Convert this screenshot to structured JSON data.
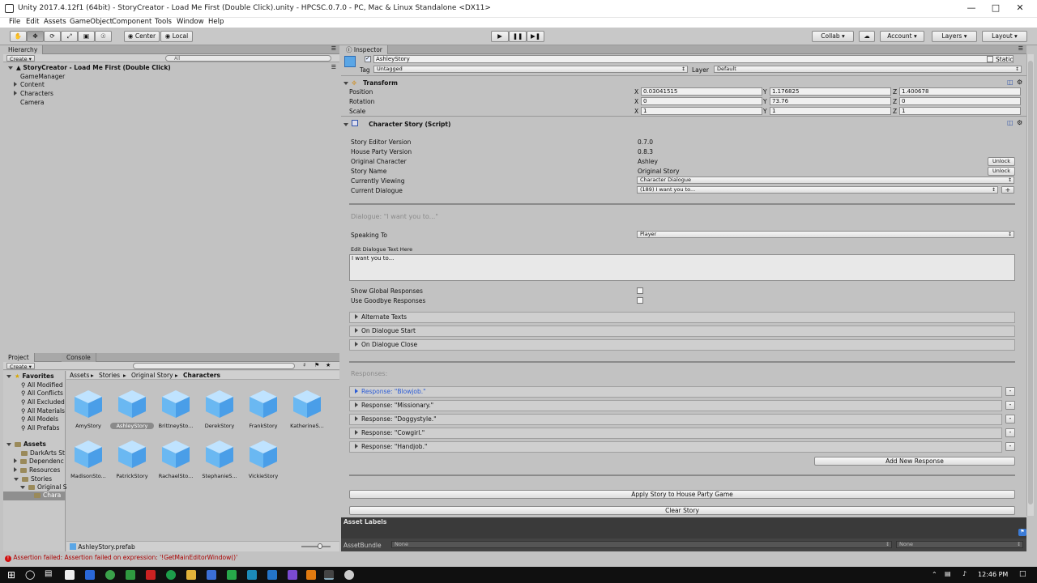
{
  "window": {
    "title": "Unity 2017.4.12f1 (64bit) - StoryCreator - Load Me First (Double Click).unity - HPCSC.0.7.0 - PC, Mac & Linux Standalone <DX11>"
  },
  "menu": [
    "File",
    "Edit",
    "Assets",
    "GameObject",
    "Component",
    "Tools",
    "Window",
    "Help"
  ],
  "toolbar": {
    "pivot": "Center",
    "space": "Local",
    "collab": "Collab ▾",
    "account": "Account",
    "layers": "Layers",
    "layout": "Layout"
  },
  "hierarchy": {
    "tab": "Hierarchy",
    "create": "Create ▾",
    "search_placeholder": "All",
    "scene": "StoryCreator - Load Me First (Double Click)",
    "items": [
      "GameManager",
      "Content",
      "Characters",
      "Camera"
    ]
  },
  "project": {
    "tabs": [
      "Project",
      "Console"
    ],
    "create": "Create ▾",
    "favorites_label": "Favorites",
    "favorites": [
      "All Modified",
      "All Conflicts",
      "All Excluded",
      "All Materials",
      "All Models",
      "All Prefabs"
    ],
    "assets_label": "Assets",
    "asset_folders": [
      "DarkArts St",
      "Dependenc",
      "Resources",
      "Stories",
      "Original S",
      "Chara"
    ],
    "breadcrumb": [
      "Assets",
      "Stories",
      "Original Story",
      "Characters"
    ],
    "files": [
      "AmyStory",
      "AshleyStory",
      "BrittneySto...",
      "DerekStory",
      "FrankStory",
      "KatherineS...",
      "MadisonSto...",
      "PatrickStory",
      "RachaelSto...",
      "StephanieS...",
      "VickieStory"
    ],
    "selected_file_path": "AshleyStory.prefab"
  },
  "status": {
    "message": "Assertion failed: Assertion failed on expression: '!GetMainEditorWindow()'"
  },
  "inspector": {
    "tab": "Inspector",
    "object_name": "AshleyStory",
    "static_label": "Static",
    "tag_label": "Tag",
    "tag_value": "Untagged",
    "layer_label": "Layer",
    "layer_value": "Default",
    "transform": {
      "header": "Transform",
      "rows": [
        {
          "label": "Position",
          "x": "0.03041515",
          "y": "1.176825",
          "z": "1.400678"
        },
        {
          "label": "Rotation",
          "x": "0",
          "y": "73.76",
          "z": "0"
        },
        {
          "label": "Scale",
          "x": "1",
          "y": "1",
          "z": "1"
        }
      ]
    },
    "script": {
      "header": "Character Story (Script)",
      "story_editor_version_label": "Story Editor Version",
      "story_editor_version": "0.7.0",
      "house_party_version_label": "House Party Version",
      "house_party_version": "0.8.3",
      "original_character_label": "Original Character",
      "original_character": "Ashley",
      "story_name_label": "Story Name",
      "story_name": "Original Story",
      "unlock": "Unlock",
      "currently_viewing_label": "Currently Viewing",
      "currently_viewing": "Character Dialogue",
      "current_dialogue_label": "Current Dialogue",
      "current_dialogue": "(189) I want you to...",
      "plus": "+",
      "dialogue_heading": "Dialogue: \"I want you to...\"",
      "speaking_to_label": "Speaking To",
      "speaking_to": "Player",
      "edit_text_label": "Edit Dialogue Text Here",
      "dialogue_text": "I want you to...",
      "show_global_label": "Show Global Responses",
      "use_goodbye_label": "Use Goodbye Responses",
      "foldouts": [
        "Alternate Texts",
        "On Dialogue Start",
        "On Dialogue Close"
      ],
      "responses_heading": "Responses:",
      "responses": [
        "Response: \"Blowjob.\"",
        "Response: \"Missionary.\"",
        "Response: \"Doggystyle.\"",
        "Response: \"Cowgirl.\"",
        "Response: \"Handjob.\""
      ],
      "minus": "-",
      "add_response": "Add New Response",
      "apply": "Apply Story to House Party Game",
      "clear": "Clear Story"
    },
    "asset_labels": "Asset Labels",
    "asset_bundle_label": "AssetBundle",
    "asset_bundle_value": "None",
    "asset_bundle_variant": "None"
  },
  "taskbar": {
    "time": "12:46 PM"
  }
}
